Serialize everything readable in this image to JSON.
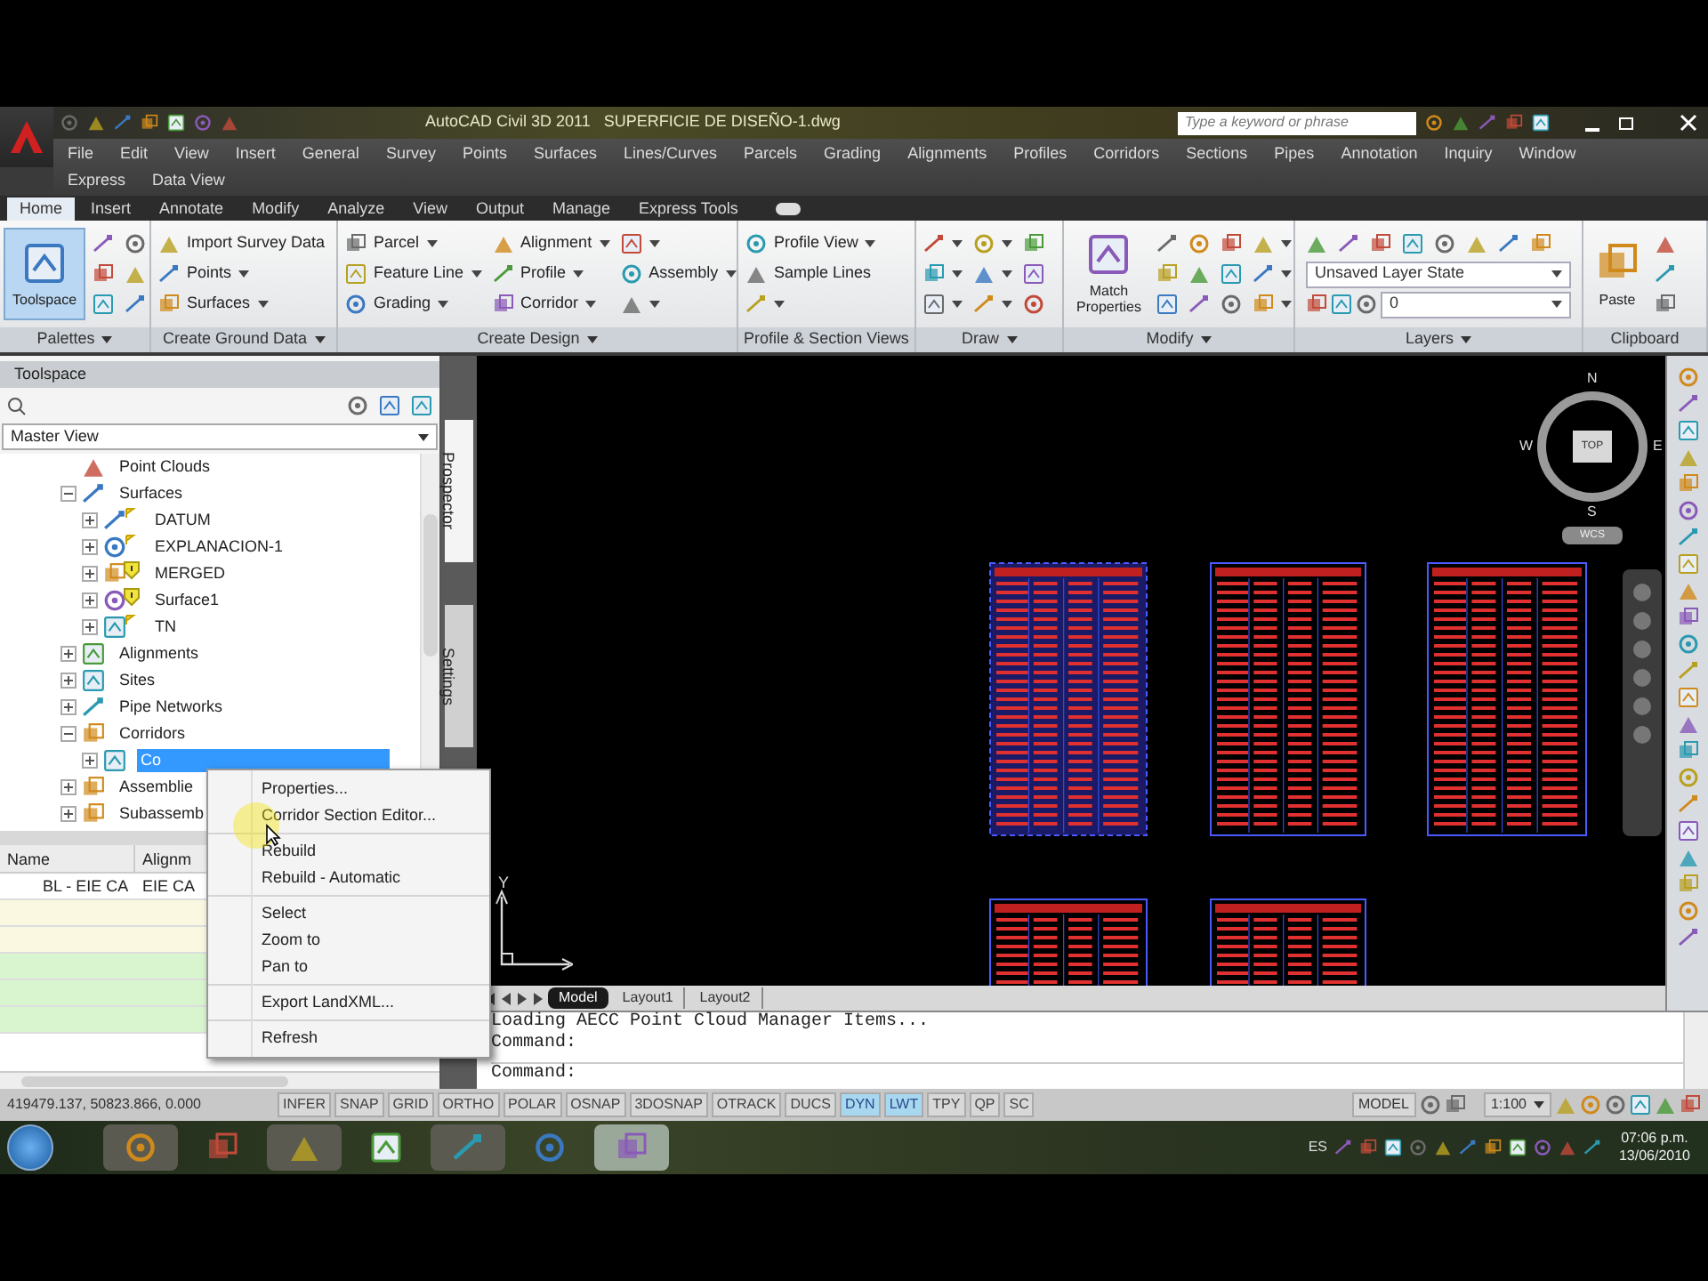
{
  "title_bar": {
    "title": "AutoCAD Civil 3D 2011   SUPERFICIE DE DISEÑO-1.dwg",
    "search": {
      "placeholder": "Type a keyword or phrase"
    }
  },
  "menu_bar": {
    "items": [
      "File",
      "Edit",
      "View",
      "Insert",
      "General",
      "Survey",
      "Points",
      "Surfaces",
      "Lines/Curves",
      "Parcels",
      "Grading",
      "Alignments",
      "Profiles",
      "Corridors",
      "Sections",
      "Pipes",
      "Annotation",
      "Inquiry",
      "Window",
      "Express",
      "Data View"
    ]
  },
  "ribbon": {
    "tabs": [
      {
        "label": "Home",
        "selected": true
      },
      {
        "label": "Insert",
        "selected": false
      },
      {
        "label": "Annotate",
        "selected": false
      },
      {
        "label": "Modify",
        "selected": false
      },
      {
        "label": "Analyze",
        "selected": false
      },
      {
        "label": "View",
        "selected": false
      },
      {
        "label": "Output",
        "selected": false
      },
      {
        "label": "Manage",
        "selected": false
      },
      {
        "label": "Express Tools",
        "selected": false
      }
    ],
    "panels": [
      {
        "title": "Palettes",
        "dropdown": true,
        "columns": [
          [
            {
              "kind": "large",
              "label": "Toolspace",
              "selected": true
            }
          ],
          [
            {
              "kind": "small",
              "dropdown": false
            },
            {
              "kind": "small",
              "dropdown": false
            },
            {
              "kind": "small",
              "dropdown": false
            }
          ],
          [
            {
              "kind": "small",
              "dropdown": false
            },
            {
              "kind": "small",
              "dropdown": false
            },
            {
              "kind": "small",
              "dropdown": false
            }
          ]
        ]
      },
      {
        "title": "Create Ground Data",
        "dropdown": true,
        "columns": [
          [
            {
              "kind": "small",
              "label": "Import Survey Data",
              "dropdown": false
            },
            {
              "kind": "small",
              "label": "Points",
              "dropdown": true
            },
            {
              "kind": "small",
              "label": "Surfaces",
              "dropdown": true
            }
          ]
        ]
      },
      {
        "title": "Create Design",
        "dropdown": true,
        "columns": [
          [
            {
              "kind": "small",
              "label": "Parcel",
              "dropdown": true
            },
            {
              "kind": "small",
              "label": "Feature Line",
              "dropdown": true
            },
            {
              "kind": "small",
              "label": "Grading",
              "dropdown": true
            }
          ],
          [
            {
              "kind": "small",
              "label": "Alignment",
              "dropdown": true
            },
            {
              "kind": "small",
              "label": "Profile",
              "dropdown": true
            },
            {
              "kind": "small",
              "label": "Corridor",
              "dropdown": true
            }
          ],
          [
            {
              "kind": "small",
              "dropdown": true
            },
            {
              "kind": "small",
              "label": "Assembly",
              "dropdown": true
            },
            {
              "kind": "small",
              "dropdown": true
            }
          ]
        ]
      },
      {
        "title": "Profile & Section Views",
        "dropdown": false,
        "columns": [
          [
            {
              "kind": "small",
              "label": "Profile View",
              "dropdown": true
            },
            {
              "kind": "small",
              "label": "Sample Lines",
              "dropdown": false
            },
            {
              "kind": "small",
              "dropdown": true
            }
          ]
        ]
      },
      {
        "title": "Draw",
        "dropdown": true,
        "columns": [
          [
            {
              "kind": "small",
              "dropdown": true
            },
            {
              "kind": "small",
              "dropdown": true
            },
            {
              "kind": "small",
              "dropdown": true
            }
          ],
          [
            {
              "kind": "small",
              "dropdown": true
            },
            {
              "kind": "small",
              "dropdown": true
            },
            {
              "kind": "small",
              "dropdown": true
            }
          ],
          [
            {
              "kind": "small",
              "dropdown": false
            },
            {
              "kind": "small",
              "dropdown": false
            },
            {
              "kind": "small",
              "dropdown": false
            }
          ]
        ]
      },
      {
        "title": "Modify",
        "dropdown": true,
        "columns": [
          [
            {
              "kind": "large",
              "label": "Match Properties",
              "selected": false
            }
          ],
          [
            {
              "kind": "small",
              "dropdown": false
            },
            {
              "kind": "small",
              "dropdown": false
            },
            {
              "kind": "small",
              "dropdown": false
            }
          ],
          [
            {
              "kind": "small",
              "dropdown": false
            },
            {
              "kind": "small",
              "dropdown": false
            },
            {
              "kind": "small",
              "dropdown": false
            }
          ],
          [
            {
              "kind": "small",
              "dropdown": false
            },
            {
              "kind": "small",
              "dropdown": false
            },
            {
              "kind": "small",
              "dropdown": false
            }
          ],
          [
            {
              "kind": "small",
              "dropdown": true
            },
            {
              "kind": "small",
              "dropdown": true
            },
            {
              "kind": "small",
              "dropdown": true
            }
          ]
        ]
      },
      {
        "title": "Layers",
        "dropdown": true,
        "columns": [
          [
            {
              "kind": "toolbar"
            },
            {
              "kind": "select",
              "value": "Unsaved Layer State"
            },
            {
              "kind": "layer_select",
              "value": "0"
            }
          ]
        ]
      },
      {
        "title": "Clipboard",
        "dropdown": false,
        "columns": [
          [
            {
              "kind": "large",
              "label": "Paste",
              "selected": false
            }
          ],
          [
            {
              "kind": "small",
              "dropdown": false
            },
            {
              "kind": "small",
              "dropdown": false
            },
            {
              "kind": "small",
              "dropdown": false
            }
          ]
        ]
      }
    ]
  },
  "toolspace": {
    "title": "Toolspace",
    "view": "Master View",
    "side_tabs": [
      {
        "label": "Prospector",
        "selected": true
      },
      {
        "label": "Settings",
        "selected": false
      }
    ],
    "tree": [
      {
        "label": "Point Clouds"
      },
      {
        "label": "Surfaces",
        "expanded": true,
        "children": [
          {
            "label": "DATUM",
            "expanded": false,
            "warning": false
          },
          {
            "label": "EXPLANACION-1",
            "expanded": false,
            "warning": false
          },
          {
            "label": "MERGED",
            "expanded": false,
            "warning": true
          },
          {
            "label": "Surface1",
            "expanded": false,
            "warning": true
          },
          {
            "label": "TN",
            "expanded": false,
            "warning": false
          }
        ]
      },
      {
        "label": "Alignments",
        "expanded": false
      },
      {
        "label": "Sites",
        "expanded": false
      },
      {
        "label": "Pipe Networks",
        "expanded": false
      },
      {
        "label": "Corridors",
        "expanded": true,
        "children": [
          {
            "label": "Co",
            "expanded": false,
            "selected": true
          }
        ]
      },
      {
        "label": "Assemblie",
        "expanded": false
      },
      {
        "label": "Subassemb",
        "expanded": false
      }
    ],
    "table": {
      "columns": [
        "Name",
        "Alignm"
      ],
      "rows": [
        {
          "cells": [
            "BL - EIE CA",
            "EIE CA"
          ],
          "color": "#ffffff"
        },
        {
          "color": "#fbf8e2"
        },
        {
          "color": "#fbf8e2"
        },
        {
          "color": "#d8f5d0"
        },
        {
          "color": "#d8f5d0"
        },
        {
          "color": "#d8f5d0"
        }
      ]
    }
  },
  "context_menu": {
    "groups": [
      [
        "Properties...",
        "Corridor Section Editor..."
      ],
      [
        "Rebuild",
        "Rebuild - Automatic"
      ],
      [
        "Select",
        "Zoom to",
        "Pan to"
      ],
      [
        "Export LandXML..."
      ],
      [
        "Refresh"
      ]
    ]
  },
  "drawing": {
    "viewcube": {
      "north": "N",
      "south": "S",
      "east": "E",
      "west": "W",
      "face": "TOP",
      "ucs": "WCS"
    },
    "ucs_label": "Y",
    "layout_tabs": [
      {
        "label": "Model",
        "selected": true
      },
      {
        "label": "Layout1",
        "selected": false
      },
      {
        "label": "Layout2",
        "selected": false
      }
    ]
  },
  "command_line": {
    "history": [
      "Loading AECC Point Cloud Manager Items...",
      "Command:"
    ],
    "prompt": "Command:"
  },
  "status_bar": {
    "coordinates": "419479.137, 50823.866, 0.000",
    "toggles": [
      {
        "label": "INFER",
        "on": false
      },
      {
        "label": "SNAP",
        "on": false
      },
      {
        "label": "GRID",
        "on": false
      },
      {
        "label": "ORTHO",
        "on": false
      },
      {
        "label": "POLAR",
        "on": false
      },
      {
        "label": "OSNAP",
        "on": false
      },
      {
        "label": "3DOSNAP",
        "on": false
      },
      {
        "label": "OTRACK",
        "on": false
      },
      {
        "label": "DUCS",
        "on": false
      },
      {
        "label": "DYN",
        "on": true
      },
      {
        "label": "LWT",
        "on": true
      },
      {
        "label": "TPY",
        "on": false
      },
      {
        "label": "QP",
        "on": false
      },
      {
        "label": "SC",
        "on": false
      }
    ],
    "model": "MODEL",
    "scale": "1:100"
  },
  "taskbar": {
    "apps": [
      {
        "selected": false
      },
      {
        "selected": false
      },
      {
        "selected": false
      },
      {
        "selected": false
      },
      {
        "selected": false
      },
      {
        "selected": false
      },
      {
        "selected": true
      }
    ],
    "language": "ES",
    "time": "07:06 p.m.",
    "date": "13/06/2010"
  }
}
